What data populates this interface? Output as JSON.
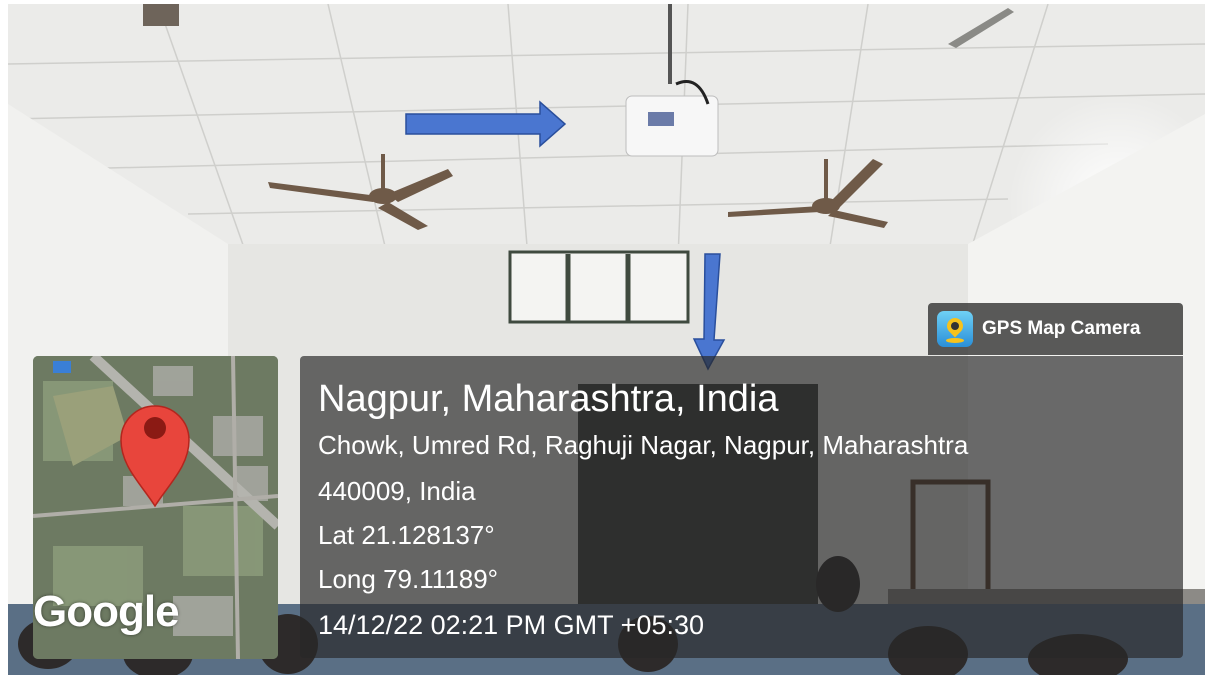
{
  "gps_badge": {
    "label": "GPS Map Camera",
    "icon": "gps-map-camera-app-icon"
  },
  "location": {
    "title": "Nagpur, Maharashtra, India",
    "address_line1": "Chowk, Umred Rd, Raghuji Nagar, Nagpur, Maharashtra",
    "address_line2": "440009, India",
    "latitude": "Lat 21.128137°",
    "longitude": "Long 79.11189°",
    "timestamp": "14/12/22 02:21 PM GMT +05:30"
  },
  "map": {
    "brand": "Google",
    "marker_icon": "map-pin-icon",
    "marker_color": "#e8453c"
  },
  "annotations": {
    "arrow_color": "#4a76d0",
    "arrows": [
      "right-arrow-to-projector",
      "down-arrow-to-screen"
    ]
  }
}
